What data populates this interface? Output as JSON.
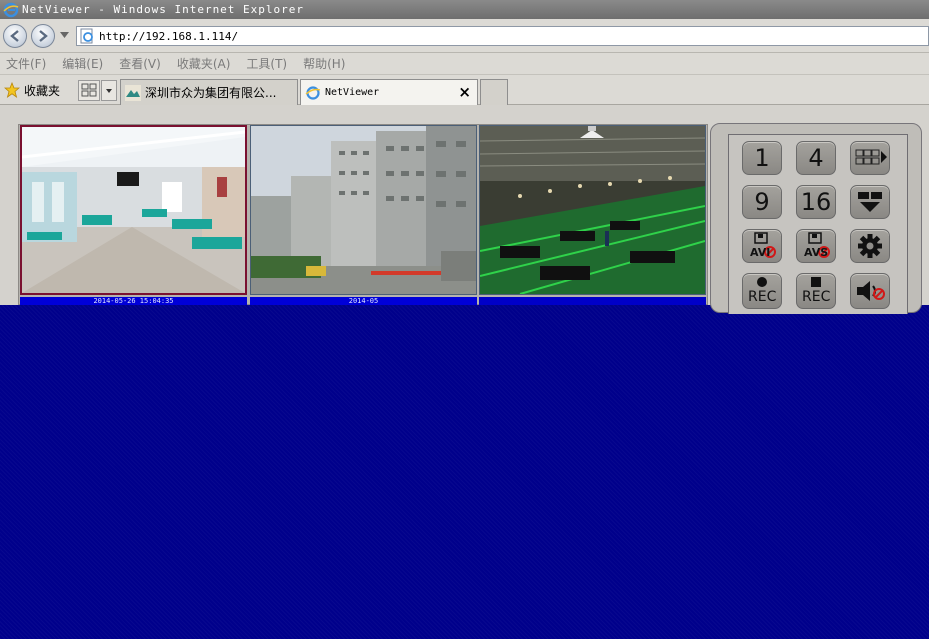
{
  "window": {
    "title": "NetViewer - Windows Internet Explorer"
  },
  "address": {
    "url": "http://192.168.1.114/"
  },
  "menu": {
    "items": [
      "文件(F)",
      "编辑(E)",
      "查看(V)",
      "收藏夹(A)",
      "工具(T)",
      "帮助(H)"
    ]
  },
  "favorites": {
    "label": "收藏夹"
  },
  "tabs": [
    {
      "label": "深圳市众为集团有限公..."
    },
    {
      "label": "NetViewer",
      "close": "×"
    }
  ],
  "cameras": [
    {
      "osd": "2014-05-26 15:04:35"
    },
    {
      "osd": "2014-05"
    },
    {
      "osd": ""
    }
  ],
  "controls": {
    "btn_1": "1",
    "btn_4": "4",
    "btn_9": "9",
    "btn_16": "16",
    "btn_avi": "AVI",
    "btn_avs": "AVS",
    "btn_rec1": "REC",
    "btn_rec2": "REC"
  },
  "colors": {
    "content_bg": "#00008b",
    "osd_bar": "#0000d8",
    "selected_cam_border": "#7a1030"
  }
}
